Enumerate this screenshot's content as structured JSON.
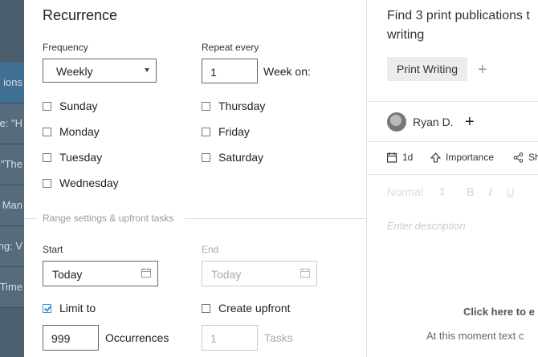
{
  "background": {
    "rows": [
      "ions",
      "e: \"H",
      ": \"The",
      "Man",
      "ing: V",
      "Time"
    ]
  },
  "modal": {
    "title": "Recurrence",
    "frequency_label": "Frequency",
    "frequency_value": "Weekly",
    "repeat_label": "Repeat every",
    "repeat_value": "1",
    "week_on_label": "Week on:",
    "days": [
      {
        "label": "Sunday",
        "checked": false
      },
      {
        "label": "Monday",
        "checked": false
      },
      {
        "label": "Tuesday",
        "checked": false
      },
      {
        "label": "Wednesday",
        "checked": false
      },
      {
        "label": "Thursday",
        "checked": false
      },
      {
        "label": "Friday",
        "checked": false
      },
      {
        "label": "Saturday",
        "checked": false
      }
    ],
    "range_title": "Range settings & upfront tasks",
    "start_label": "Start",
    "start_value": "Today",
    "end_label": "End",
    "end_value": "Today",
    "limit_label": "Limit to",
    "limit_checked": true,
    "occurrences_value": "999",
    "occurrences_label": "Occurrences",
    "create_upfront_label": "Create upfront",
    "create_upfront_checked": false,
    "tasks_value": "1",
    "tasks_label": "Tasks"
  },
  "task": {
    "title_line1": "Find 3 print publications t",
    "title_line2": "writing",
    "tag": "Print Writing",
    "assignee": "Ryan D.",
    "toolbar": {
      "duration": "1d",
      "importance": "Importance",
      "share": "Sh"
    },
    "editor": {
      "format": "Normal",
      "format_arrow": "⇕",
      "bold": "B",
      "italic": "I",
      "underline": "U",
      "placeholder": "Enter description"
    },
    "hint_line1": "Click here to e",
    "hint_line2": "At this moment text c"
  },
  "colors": {
    "checkbox_checked": "#3a8ad0",
    "background_app": "#4d6171"
  }
}
